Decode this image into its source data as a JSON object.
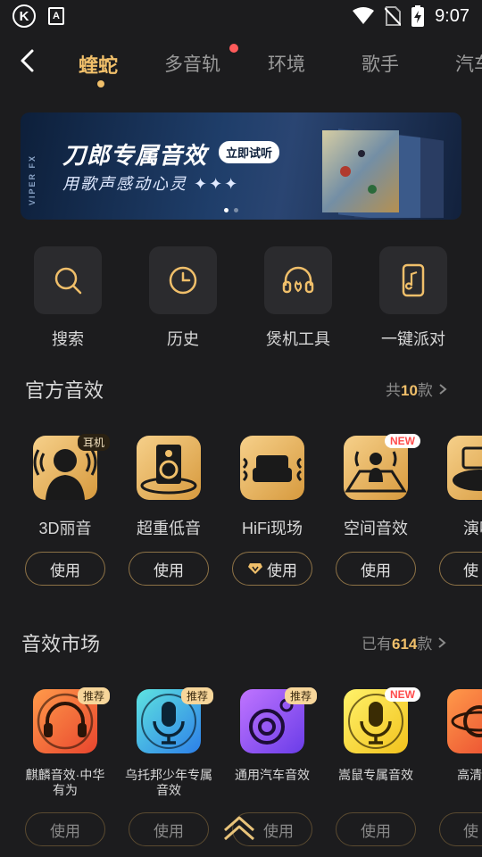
{
  "status_bar": {
    "time": "9:07",
    "icons": [
      "k-app-icon",
      "a-notification-icon",
      "wifi-icon",
      "no-sim-icon",
      "battery-charging-icon"
    ]
  },
  "nav": {
    "tabs": [
      {
        "label": "蝰蛇",
        "active": true
      },
      {
        "label": "多音轨",
        "has_dot": true
      },
      {
        "label": "环境"
      },
      {
        "label": "歌手"
      },
      {
        "label": "汽车"
      }
    ]
  },
  "banner": {
    "side_text": "VIPER FX",
    "title": "刀郎专属音效",
    "button": "立即试听",
    "subtitle": "用歌声感动心灵 ✦✦✦"
  },
  "quick_actions": [
    {
      "label": "搜索",
      "icon": "search-icon"
    },
    {
      "label": "历史",
      "icon": "clock-icon"
    },
    {
      "label": "煲机工具",
      "icon": "headphone-tool-icon"
    },
    {
      "label": "一键派对",
      "icon": "party-phone-icon"
    }
  ],
  "official": {
    "title": "官方音效",
    "more_prefix": "共",
    "count": "10",
    "more_suffix": "款",
    "items": [
      {
        "name": "3D丽音",
        "badge": "耳机",
        "button": "使用"
      },
      {
        "name": "超重低音",
        "button": "使用"
      },
      {
        "name": "HiFi现场",
        "button": "使用"
      },
      {
        "name": "空间音效",
        "badge": "NEW",
        "button": "使用"
      },
      {
        "name": "演唱",
        "button": "使"
      }
    ]
  },
  "market": {
    "title": "音效市场",
    "more_prefix": "已有",
    "count": "614",
    "more_suffix": "款",
    "items": [
      {
        "name": "麒麟音效·中华有为",
        "badge": "推荐",
        "button": "使用"
      },
      {
        "name": "乌托邦少年专属音效",
        "badge": "推荐",
        "button": "使用"
      },
      {
        "name": "通用汽车音效",
        "badge": "推荐",
        "button": "使用"
      },
      {
        "name": "嵩鼠专属音效",
        "badge": "NEW",
        "button": "使用"
      },
      {
        "name": "高清HiF",
        "button": "使"
      }
    ]
  },
  "colors": {
    "accent": "#f0bf6a",
    "background": "#1c1c1e",
    "tile": "#2b2b2e"
  }
}
